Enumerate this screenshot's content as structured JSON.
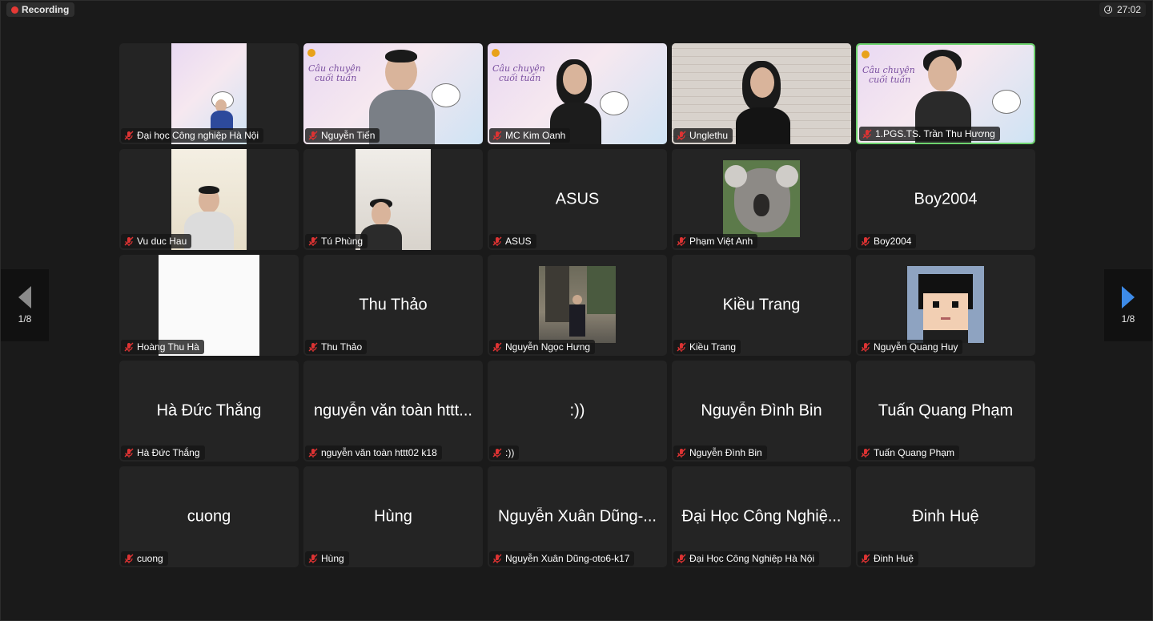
{
  "recording": {
    "label": "Recording"
  },
  "timer": {
    "value": "27:02"
  },
  "pagination": {
    "left": "1/8",
    "right": "1/8"
  },
  "banner": {
    "title_line1": "Câu chuyện",
    "title_line2": "cuối tuần"
  },
  "tiles": [
    {
      "display": "",
      "name": "Đại học Công nghiệp Hà Nội"
    },
    {
      "display": "",
      "name": "Nguyễn Tiến"
    },
    {
      "display": "",
      "name": "MC Kim Oanh"
    },
    {
      "display": "",
      "name": "Unglethu"
    },
    {
      "display": "",
      "name": "1.PGS.TS. Trần Thu Hương"
    },
    {
      "display": "",
      "name": "Vu duc Hau"
    },
    {
      "display": "",
      "name": "Tú Phùng"
    },
    {
      "display": "ASUS",
      "name": "ASUS"
    },
    {
      "display": "",
      "name": "Phạm Việt Anh"
    },
    {
      "display": "Boy2004",
      "name": "Boy2004"
    },
    {
      "display": "",
      "name": "Hoàng Thu Hà"
    },
    {
      "display": "Thu Thảo",
      "name": "Thu Thảo"
    },
    {
      "display": "",
      "name": "Nguyễn Ngọc Hưng"
    },
    {
      "display": "Kiều Trang",
      "name": "Kiều Trang"
    },
    {
      "display": "",
      "name": "Nguyễn Quang Huy"
    },
    {
      "display": "Hà Đức Thắng",
      "name": "Hà Đức Thắng"
    },
    {
      "display": "nguyễn văn toàn httt...",
      "name": "nguyễn văn toàn httt02 k18"
    },
    {
      "display": ":))",
      "name": ":))"
    },
    {
      "display": "Nguyễn Đình Bin",
      "name": "Nguyễn Đình Bin"
    },
    {
      "display": "Tuấn Quang Phạm",
      "name": "Tuấn Quang Phạm"
    },
    {
      "display": "cuong",
      "name": "cuong"
    },
    {
      "display": "Hùng",
      "name": "Hùng"
    },
    {
      "display": "Nguyễn Xuân Dũng-...",
      "name": "Nguyễn Xuân Dũng-oto6-k17"
    },
    {
      "display": "Đại Học Công Nghiệ...",
      "name": "Đại Học Công Nghiệp Hà Nội"
    },
    {
      "display": "Đinh Huệ",
      "name": "Đinh Huệ"
    }
  ]
}
